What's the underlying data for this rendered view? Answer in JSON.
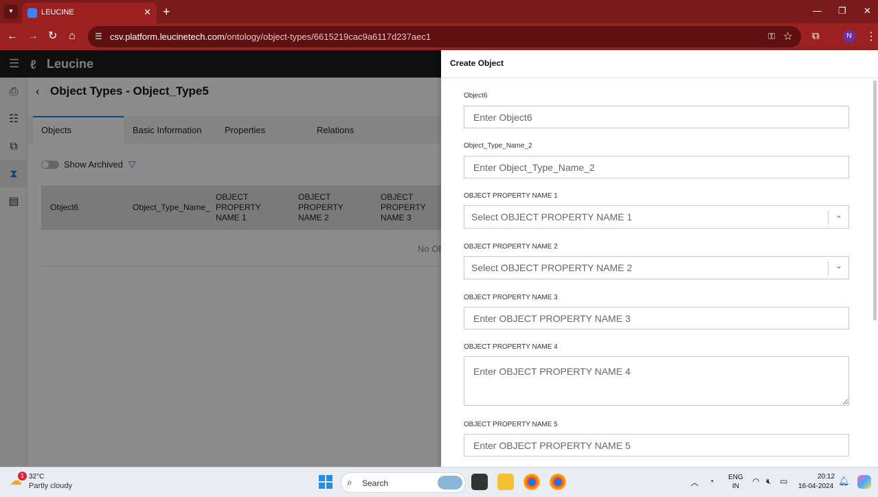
{
  "browser": {
    "tab_title": "LEUCINE",
    "tab_close": "✕",
    "new_tab": "+",
    "url_host": "csv.platform.leucinetech.com",
    "url_path": "/ontology/object-types/6615219cac9a6117d237aec1",
    "profile_initial": "N",
    "window_controls": {
      "minimize": "—",
      "maximize": "❐",
      "close": "✕"
    }
  },
  "app": {
    "logo_text": "Leucine",
    "page_title": "Object Types - Object_Type5",
    "tabs": [
      {
        "label": "Objects"
      },
      {
        "label": "Basic Information"
      },
      {
        "label": "Properties"
      },
      {
        "label": "Relations"
      }
    ],
    "show_archived_label": "Show Archived",
    "table": {
      "headers": [
        {
          "line1": "Object6",
          "line2": "",
          "line3": ""
        },
        {
          "line1": "Object_Type_Name_",
          "line2": "",
          "line3": ""
        },
        {
          "line1": "OBJECT",
          "line2": "PROPERTY",
          "line3": "NAME 1"
        },
        {
          "line1": "OBJECT",
          "line2": "PROPERTY",
          "line3": "NAME 2"
        },
        {
          "line1": "OBJECT",
          "line2": "PROPERTY",
          "line3": "NAME 3"
        }
      ],
      "empty_text": "No Ob"
    }
  },
  "drawer": {
    "title": "Create Object",
    "fields": [
      {
        "label": "Object6",
        "type": "text",
        "placeholder": "Enter Object6"
      },
      {
        "label": "Object_Type_Name_2",
        "type": "text",
        "placeholder": "Enter Object_Type_Name_2"
      },
      {
        "label": "OBJECT PROPERTY NAME 1",
        "type": "select",
        "placeholder": "Select OBJECT PROPERTY NAME 1"
      },
      {
        "label": "OBJECT PROPERTY NAME 2",
        "type": "select",
        "placeholder": "Select OBJECT PROPERTY NAME 2"
      },
      {
        "label": "OBJECT PROPERTY NAME 3",
        "type": "text",
        "placeholder": "Enter OBJECT PROPERTY NAME 3"
      },
      {
        "label": "OBJECT PROPERTY NAME 4",
        "type": "textarea",
        "placeholder": "Enter OBJECT PROPERTY NAME 4"
      },
      {
        "label": "OBJECT PROPERTY NAME 5",
        "type": "text",
        "placeholder": "Enter OBJECT PROPERTY NAME 5"
      }
    ]
  },
  "taskbar": {
    "weather_badge": "1",
    "weather_temp": "32°C",
    "weather_desc": "Partly cloudy",
    "search_label": "Search",
    "lang_line1": "ENG",
    "lang_line2": "IN",
    "time": "20:12",
    "date": "16-04-2024"
  },
  "colors": {
    "browser_frame": "#7a1a1a",
    "app_header": "#1c1c1c",
    "accent": "#1d7fe0"
  }
}
